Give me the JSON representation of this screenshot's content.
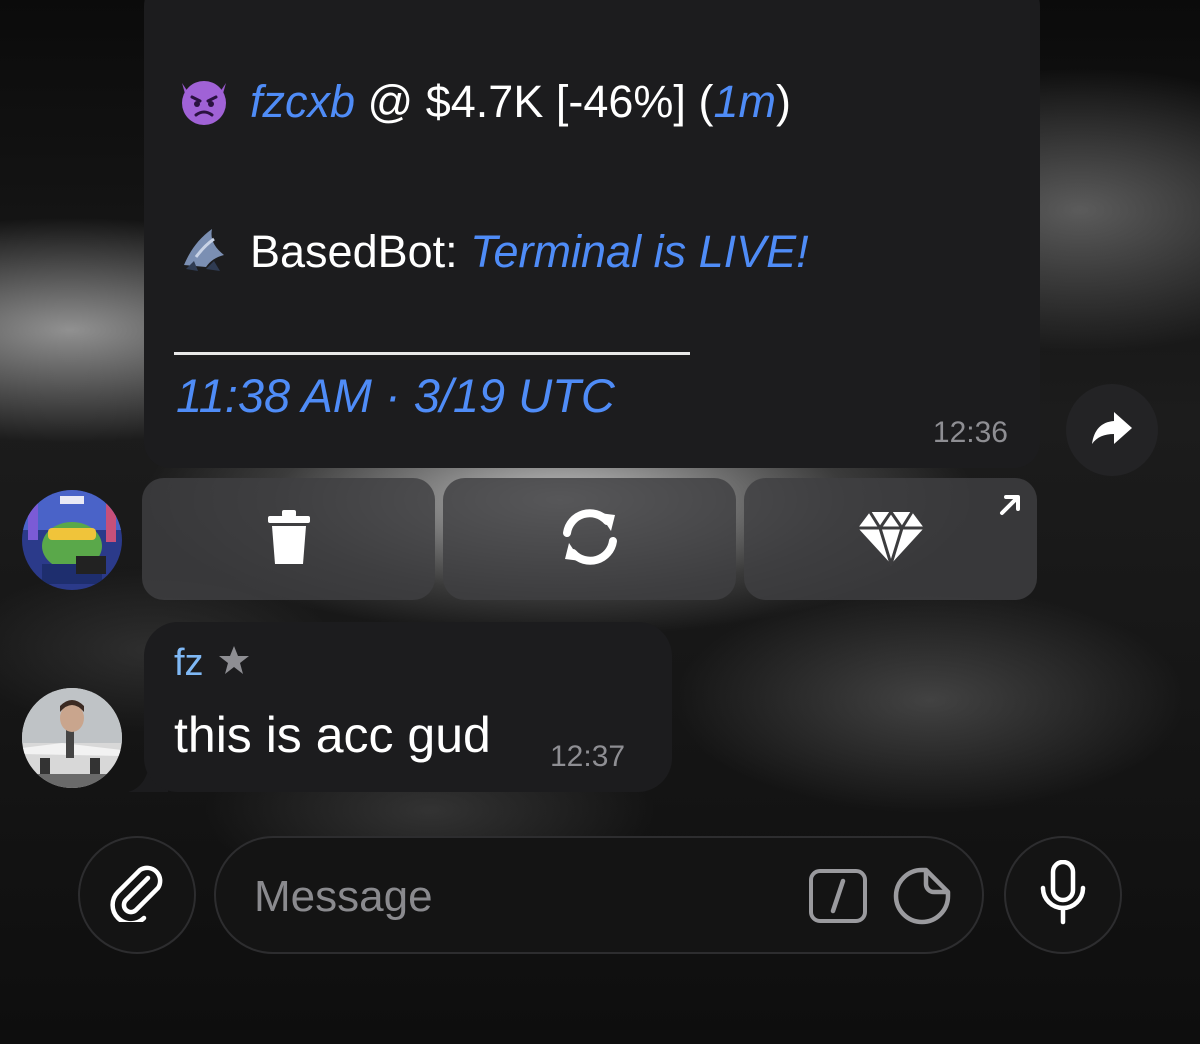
{
  "bot_message": {
    "line1": {
      "emoji_icon": "devil-face-icon",
      "token_name": "fzcxb",
      "at_sign": "@",
      "price": "$4.7K",
      "change": "[-46%]",
      "paren_open": "(",
      "age": "1m",
      "paren_close": ")"
    },
    "line2": {
      "bot_icon": "basedbot-logo-icon",
      "bot_label": "BasedBot:",
      "link_text": "Terminal is LIVE!"
    },
    "datetime": "11:38 AM · 3/19 UTC",
    "time": "12:36"
  },
  "inline_keyboard": [
    {
      "icon": "trash-icon"
    },
    {
      "icon": "refresh-icon"
    },
    {
      "icon": "diamond-icon",
      "corner_icon": "external-link-arrow-icon"
    }
  ],
  "user_message": {
    "sender": "fz",
    "sender_badge": "star-icon",
    "text": "this is acc gud",
    "time": "12:37"
  },
  "composer": {
    "placeholder": "Message",
    "attach_icon": "paperclip-icon",
    "command_icon": "slash-command-icon",
    "sticker_icon": "sticker-icon",
    "mic_icon": "microphone-icon"
  },
  "share_icon": "share-arrow-icon",
  "colors": {
    "link": "#4f8cf7",
    "sender": "#7fb8f5",
    "bubble": "#1c1c1e",
    "timestamp": "#8e8e93"
  }
}
